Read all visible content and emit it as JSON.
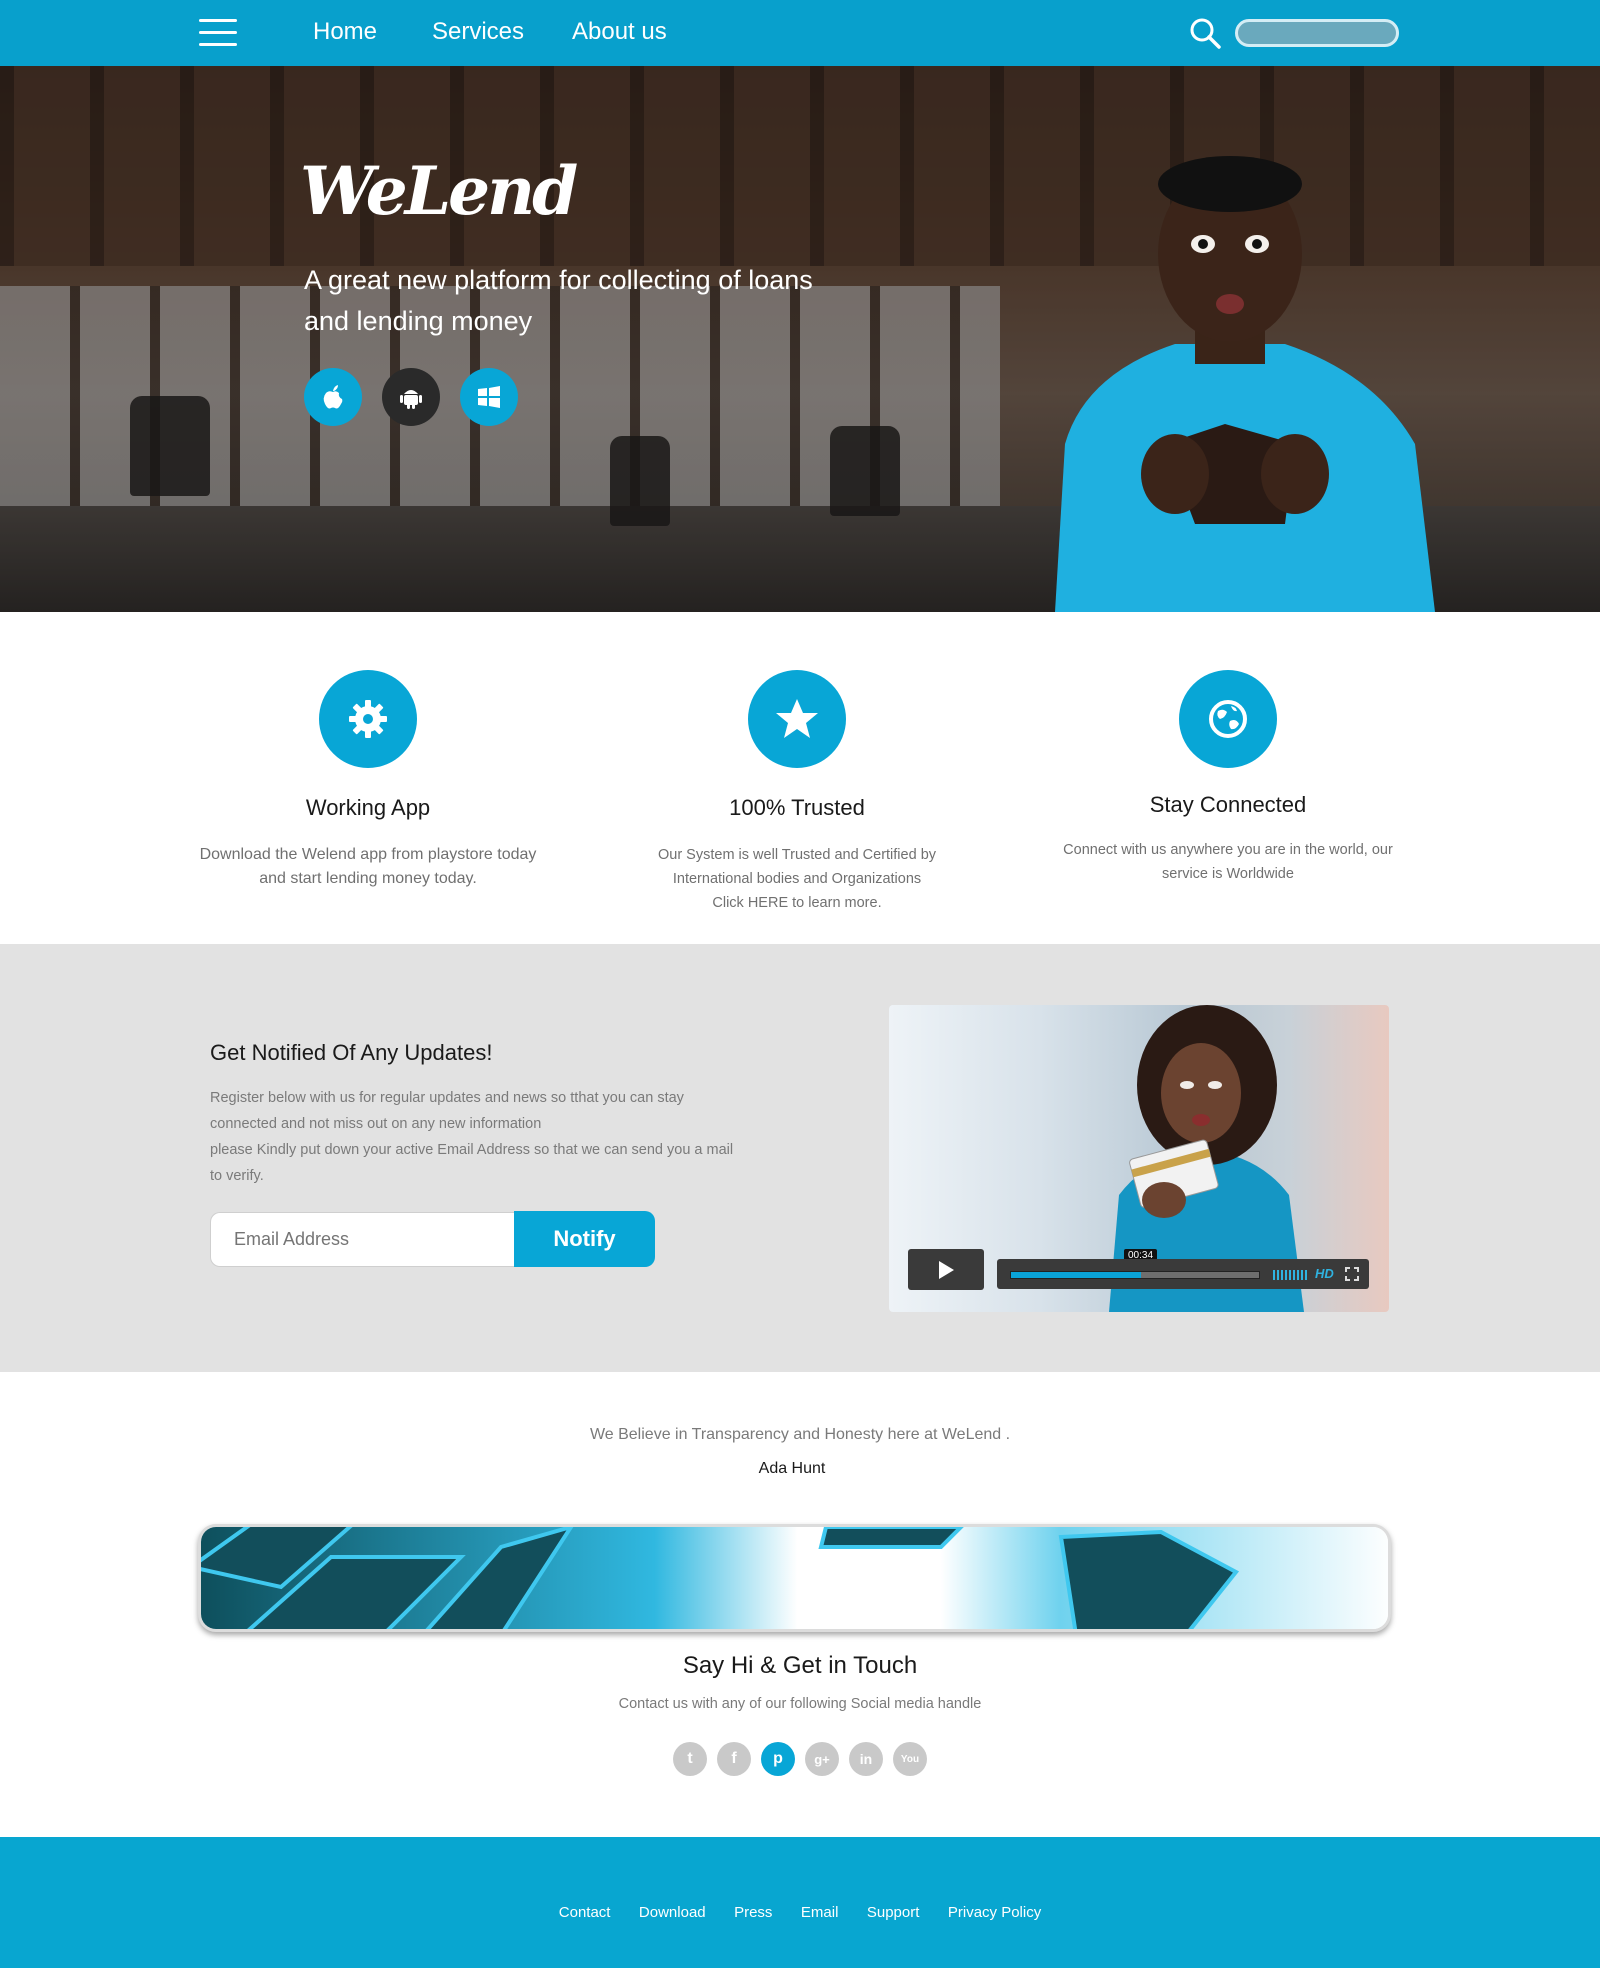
{
  "nav": {
    "links": [
      "Home",
      "Services",
      "About us"
    ],
    "search_placeholder": ""
  },
  "hero": {
    "brand": "WeLend",
    "tagline": "A great new platform for collecting of loans and lending money",
    "store_buttons": [
      {
        "icon": "apple-icon",
        "color": "#08a6d6"
      },
      {
        "icon": "android-icon",
        "color": "#2a2a2a"
      },
      {
        "icon": "windows-icon",
        "color": "#08a6d6"
      }
    ]
  },
  "features": [
    {
      "icon": "gear-icon",
      "title": "Working App",
      "text": [
        "Download the Welend app from playstore today",
        "and start lending money today."
      ]
    },
    {
      "icon": "star-icon",
      "title": "100% Trusted",
      "text": [
        "Our System is  well Trusted and Certified by",
        "International bodies and Organizations",
        "Click HERE to learn more."
      ]
    },
    {
      "icon": "globe-icon",
      "title": "Stay Connected",
      "text": [
        "Connect with us anywhere you are in the world, our",
        "service is Worldwide"
      ]
    }
  ],
  "notify": {
    "title": "Get Notified Of Any Updates!",
    "text": [
      "Register below with us for  regular updates and news so tthat you can stay",
      "connected and  not miss out on any new information",
      "please Kindly put down your active Email Address so that we can send you a mail",
      "to verify."
    ],
    "email_placeholder": "Email Address",
    "button": "Notify"
  },
  "video": {
    "time": "00:34",
    "progress": 0.52,
    "hd": "HD"
  },
  "quote": {
    "text": "We Believe in Transparency and Honesty here at WeLend .",
    "author": "Ada Hunt"
  },
  "touch": {
    "title": "Say Hi & Get in Touch",
    "text": "Contact us with any of our following Social media handle",
    "social": [
      {
        "icon": "twitter-icon",
        "glyph": "t"
      },
      {
        "icon": "facebook-icon",
        "glyph": "f"
      },
      {
        "icon": "pinterest-icon",
        "glyph": "p"
      },
      {
        "icon": "googleplus-icon",
        "glyph": "g+"
      },
      {
        "icon": "linkedin-icon",
        "glyph": "in"
      },
      {
        "icon": "youtube-icon",
        "glyph": "You"
      }
    ]
  },
  "footer": {
    "links": [
      "Contact",
      "Download",
      "Press",
      "Email",
      "Support",
      "Privacy Policy"
    ]
  },
  "colors": {
    "accent": "#08a6d6",
    "nav": "#08a0cc",
    "band": "#e2e2e2"
  }
}
